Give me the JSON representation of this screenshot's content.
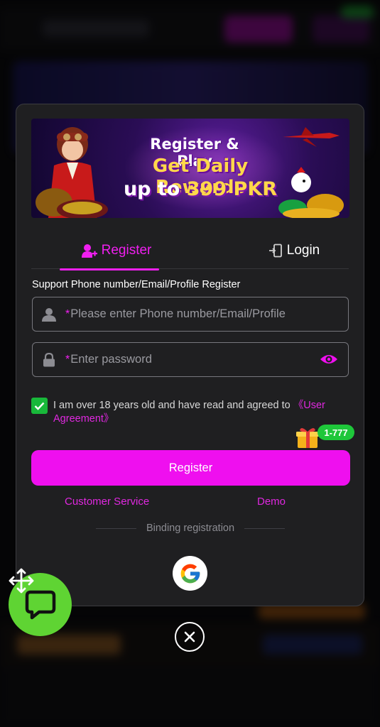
{
  "banner": {
    "line1": "Register & Play",
    "line2": "Get Daily Rewards",
    "line3_prefix": "up to ",
    "line3_highlight": "399 PKR"
  },
  "tabs": {
    "register_label": "Register",
    "login_label": "Login",
    "active": "register"
  },
  "form": {
    "support_text": "Support Phone number/Email/Profile Register",
    "phone_placeholder": "Please enter Phone number/Email/Profile",
    "password_placeholder": "Enter password",
    "required_mark": "*"
  },
  "agreement": {
    "checked": true,
    "text": "I am over 18 years old and have read and agreed to ",
    "link": "《User Agreement》"
  },
  "promo_badge": "1-777",
  "register_button": "Register",
  "links": {
    "customer_service": "Customer Service",
    "demo": "Demo"
  },
  "binding_label": "Binding registration",
  "colors": {
    "accent": "#ef0fef",
    "success": "#18b83a",
    "modal_bg": "#1f1f21",
    "chat_fab": "#5fd433"
  },
  "icons": {
    "register_tab": "user-plus-icon",
    "login_tab": "login-door-icon",
    "phone_field": "user-icon",
    "password_field": "lock-icon",
    "password_toggle": "eye-icon",
    "gift": "gift-icon",
    "social": "google-icon",
    "close": "close-circle-icon",
    "chat": "chat-bubble-icon",
    "drag": "move-arrows-icon"
  }
}
